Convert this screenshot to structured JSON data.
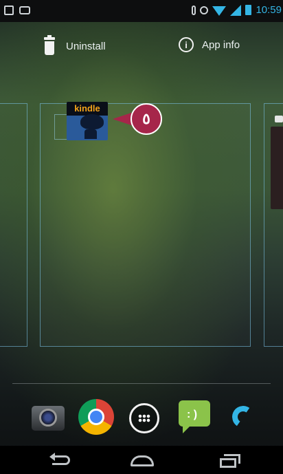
{
  "status_bar": {
    "time": "10:59"
  },
  "drop_targets": {
    "uninstall_label": "Uninstall",
    "app_info_label": "App info"
  },
  "dragged_app": {
    "label": "kindle",
    "icon": "kindle-icon"
  },
  "callout": {
    "number": "٥",
    "color": "#a6264a"
  },
  "hotseat": {
    "icons": [
      "camera-icon",
      "chrome-icon",
      "all-apps-icon",
      "messenger-icon",
      "phone-icon"
    ]
  },
  "nav_bar": {
    "icons": [
      "back-icon",
      "home-icon",
      "recents-icon"
    ]
  },
  "colors": {
    "accent": "#34b5e5",
    "panel_outline": "#78bee1",
    "kindle_label": "#f4a31a"
  }
}
